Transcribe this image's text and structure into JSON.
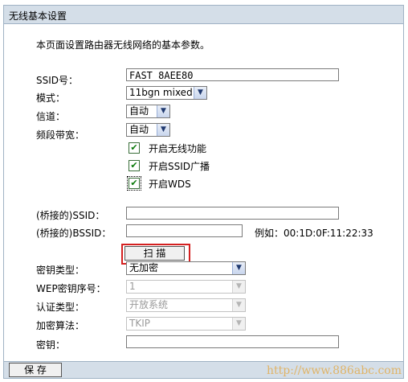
{
  "panel": {
    "title": "无线基本设置",
    "description": "本页面设置路由器无线网络的基本参数。"
  },
  "fields": {
    "ssid_label": "SSID号：",
    "ssid_value": "FAST_8AEE80",
    "mode_label": "模式：",
    "mode_value": "11bgn mixed",
    "channel_label": "信道：",
    "channel_value": "自动",
    "bandwidth_label": "频段带宽：",
    "bandwidth_value": "自动",
    "enable_wireless": "开启无线功能",
    "enable_ssid_broadcast": "开启SSID广播",
    "enable_wds": "开启WDS",
    "bridge_ssid_label": "(桥接的)SSID：",
    "bridge_ssid_value": "",
    "bridge_bssid_label": "(桥接的)BSSID：",
    "bridge_bssid_value": "",
    "bssid_example": "例如：00:1D:0F:11:22:33",
    "scan_button": "扫 描",
    "key_type_label": "密钥类型：",
    "key_type_value": "无加密",
    "wep_index_label": "WEP密钥序号：",
    "wep_index_value": "1",
    "auth_type_label": "认证类型：",
    "auth_type_value": "开放系统",
    "encrypt_label": "加密算法：",
    "encrypt_value": "TKIP",
    "key_label": "密钥：",
    "key_value": ""
  },
  "checks": {
    "wireless": true,
    "ssid_broadcast": true,
    "wds": true
  },
  "footer": {
    "save_button": "保 存"
  },
  "watermark": "http://www.886abc.com",
  "icons": {
    "dropdown": "chevron-down-icon",
    "check": "checkmark-icon"
  },
  "colors": {
    "header_bg": "#d4dee8",
    "highlight": "#d42020",
    "checkmark": "#0a7a0a"
  }
}
